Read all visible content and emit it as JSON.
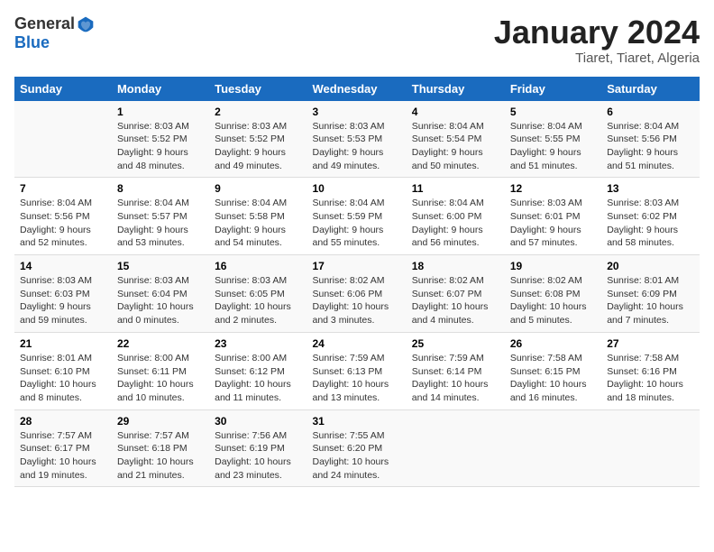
{
  "header": {
    "logo_general": "General",
    "logo_blue": "Blue",
    "month_year": "January 2024",
    "location": "Tiaret, Tiaret, Algeria"
  },
  "calendar": {
    "days_of_week": [
      "Sunday",
      "Monday",
      "Tuesday",
      "Wednesday",
      "Thursday",
      "Friday",
      "Saturday"
    ],
    "weeks": [
      [
        {
          "day": "",
          "info": ""
        },
        {
          "day": "1",
          "info": "Sunrise: 8:03 AM\nSunset: 5:52 PM\nDaylight: 9 hours\nand 48 minutes."
        },
        {
          "day": "2",
          "info": "Sunrise: 8:03 AM\nSunset: 5:52 PM\nDaylight: 9 hours\nand 49 minutes."
        },
        {
          "day": "3",
          "info": "Sunrise: 8:03 AM\nSunset: 5:53 PM\nDaylight: 9 hours\nand 49 minutes."
        },
        {
          "day": "4",
          "info": "Sunrise: 8:04 AM\nSunset: 5:54 PM\nDaylight: 9 hours\nand 50 minutes."
        },
        {
          "day": "5",
          "info": "Sunrise: 8:04 AM\nSunset: 5:55 PM\nDaylight: 9 hours\nand 51 minutes."
        },
        {
          "day": "6",
          "info": "Sunrise: 8:04 AM\nSunset: 5:56 PM\nDaylight: 9 hours\nand 51 minutes."
        }
      ],
      [
        {
          "day": "7",
          "info": "Sunrise: 8:04 AM\nSunset: 5:56 PM\nDaylight: 9 hours\nand 52 minutes."
        },
        {
          "day": "8",
          "info": "Sunrise: 8:04 AM\nSunset: 5:57 PM\nDaylight: 9 hours\nand 53 minutes."
        },
        {
          "day": "9",
          "info": "Sunrise: 8:04 AM\nSunset: 5:58 PM\nDaylight: 9 hours\nand 54 minutes."
        },
        {
          "day": "10",
          "info": "Sunrise: 8:04 AM\nSunset: 5:59 PM\nDaylight: 9 hours\nand 55 minutes."
        },
        {
          "day": "11",
          "info": "Sunrise: 8:04 AM\nSunset: 6:00 PM\nDaylight: 9 hours\nand 56 minutes."
        },
        {
          "day": "12",
          "info": "Sunrise: 8:03 AM\nSunset: 6:01 PM\nDaylight: 9 hours\nand 57 minutes."
        },
        {
          "day": "13",
          "info": "Sunrise: 8:03 AM\nSunset: 6:02 PM\nDaylight: 9 hours\nand 58 minutes."
        }
      ],
      [
        {
          "day": "14",
          "info": "Sunrise: 8:03 AM\nSunset: 6:03 PM\nDaylight: 9 hours\nand 59 minutes."
        },
        {
          "day": "15",
          "info": "Sunrise: 8:03 AM\nSunset: 6:04 PM\nDaylight: 10 hours\nand 0 minutes."
        },
        {
          "day": "16",
          "info": "Sunrise: 8:03 AM\nSunset: 6:05 PM\nDaylight: 10 hours\nand 2 minutes."
        },
        {
          "day": "17",
          "info": "Sunrise: 8:02 AM\nSunset: 6:06 PM\nDaylight: 10 hours\nand 3 minutes."
        },
        {
          "day": "18",
          "info": "Sunrise: 8:02 AM\nSunset: 6:07 PM\nDaylight: 10 hours\nand 4 minutes."
        },
        {
          "day": "19",
          "info": "Sunrise: 8:02 AM\nSunset: 6:08 PM\nDaylight: 10 hours\nand 5 minutes."
        },
        {
          "day": "20",
          "info": "Sunrise: 8:01 AM\nSunset: 6:09 PM\nDaylight: 10 hours\nand 7 minutes."
        }
      ],
      [
        {
          "day": "21",
          "info": "Sunrise: 8:01 AM\nSunset: 6:10 PM\nDaylight: 10 hours\nand 8 minutes."
        },
        {
          "day": "22",
          "info": "Sunrise: 8:00 AM\nSunset: 6:11 PM\nDaylight: 10 hours\nand 10 minutes."
        },
        {
          "day": "23",
          "info": "Sunrise: 8:00 AM\nSunset: 6:12 PM\nDaylight: 10 hours\nand 11 minutes."
        },
        {
          "day": "24",
          "info": "Sunrise: 7:59 AM\nSunset: 6:13 PM\nDaylight: 10 hours\nand 13 minutes."
        },
        {
          "day": "25",
          "info": "Sunrise: 7:59 AM\nSunset: 6:14 PM\nDaylight: 10 hours\nand 14 minutes."
        },
        {
          "day": "26",
          "info": "Sunrise: 7:58 AM\nSunset: 6:15 PM\nDaylight: 10 hours\nand 16 minutes."
        },
        {
          "day": "27",
          "info": "Sunrise: 7:58 AM\nSunset: 6:16 PM\nDaylight: 10 hours\nand 18 minutes."
        }
      ],
      [
        {
          "day": "28",
          "info": "Sunrise: 7:57 AM\nSunset: 6:17 PM\nDaylight: 10 hours\nand 19 minutes."
        },
        {
          "day": "29",
          "info": "Sunrise: 7:57 AM\nSunset: 6:18 PM\nDaylight: 10 hours\nand 21 minutes."
        },
        {
          "day": "30",
          "info": "Sunrise: 7:56 AM\nSunset: 6:19 PM\nDaylight: 10 hours\nand 23 minutes."
        },
        {
          "day": "31",
          "info": "Sunrise: 7:55 AM\nSunset: 6:20 PM\nDaylight: 10 hours\nand 24 minutes."
        },
        {
          "day": "",
          "info": ""
        },
        {
          "day": "",
          "info": ""
        },
        {
          "day": "",
          "info": ""
        }
      ]
    ]
  }
}
